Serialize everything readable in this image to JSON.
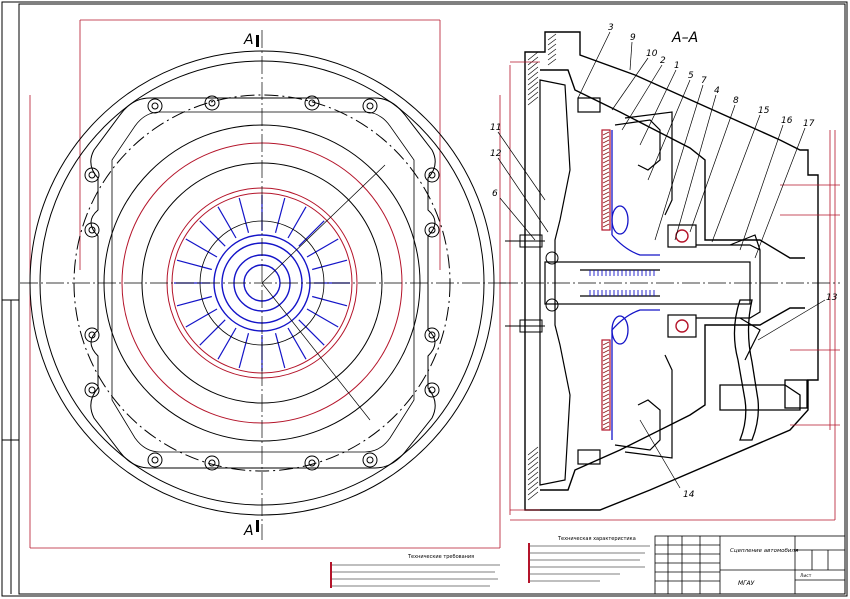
{
  "section_view": {
    "section_title": "А–А",
    "cut_label_top": "А",
    "cut_label_bottom": "А"
  },
  "callouts": [
    "3",
    "9",
    "10",
    "2",
    "1",
    "5",
    "7",
    "4",
    "8",
    "15",
    "16",
    "17",
    "11",
    "12",
    "6",
    "13",
    "14"
  ],
  "colors": {
    "line": "#000000",
    "blue": "#1414c8",
    "red": "#b4142a",
    "hatch": "#8b1a1a"
  },
  "blocks": {
    "notes_left": "Технические требования",
    "spec_center": "Техническая характеристика",
    "stamp_title": "Сцепление автомобиля",
    "stamp_company": "МГАУ",
    "stamp_sheet": "Лист"
  }
}
